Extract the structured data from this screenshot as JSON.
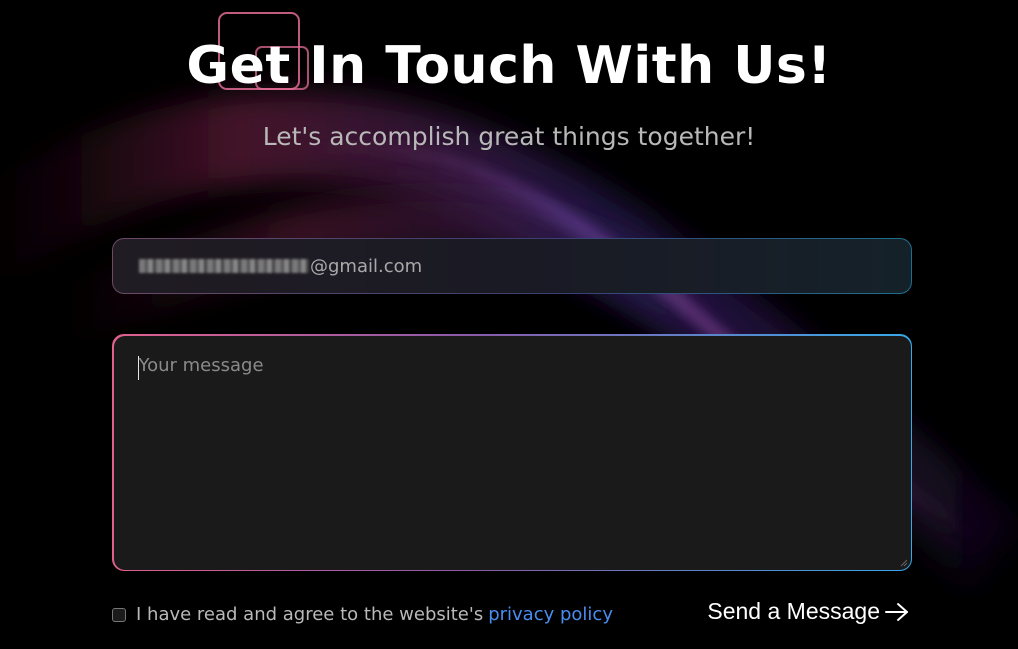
{
  "header": {
    "title": "Get In Touch With Us!",
    "subtitle": "Let's accomplish great things together!"
  },
  "form": {
    "email": {
      "value_visible": "@gmail.com",
      "value_redacted": true
    },
    "message": {
      "placeholder": "Your message",
      "value": ""
    },
    "consent": {
      "checked": false,
      "text": "I have read and agree to the website's",
      "link_text": "privacy policy"
    },
    "submit": {
      "label": "Send a Message",
      "icon": "arrow-right-icon"
    }
  },
  "colors": {
    "background": "#000000",
    "link": "#4a8df0",
    "border_gradient_start": "#e0608e",
    "border_gradient_end": "#36a9e8"
  }
}
